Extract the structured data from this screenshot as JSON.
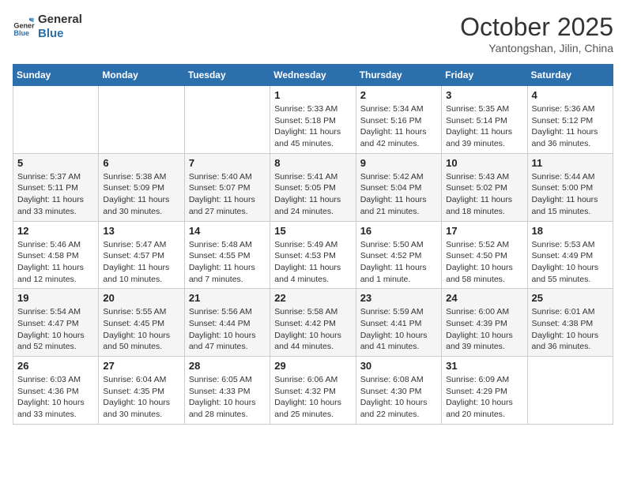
{
  "header": {
    "logo_line1": "General",
    "logo_line2": "Blue",
    "month": "October 2025",
    "location": "Yantongshan, Jilin, China"
  },
  "weekdays": [
    "Sunday",
    "Monday",
    "Tuesday",
    "Wednesday",
    "Thursday",
    "Friday",
    "Saturday"
  ],
  "weeks": [
    [
      {
        "day": "",
        "info": ""
      },
      {
        "day": "",
        "info": ""
      },
      {
        "day": "",
        "info": ""
      },
      {
        "day": "1",
        "info": "Sunrise: 5:33 AM\nSunset: 5:18 PM\nDaylight: 11 hours\nand 45 minutes."
      },
      {
        "day": "2",
        "info": "Sunrise: 5:34 AM\nSunset: 5:16 PM\nDaylight: 11 hours\nand 42 minutes."
      },
      {
        "day": "3",
        "info": "Sunrise: 5:35 AM\nSunset: 5:14 PM\nDaylight: 11 hours\nand 39 minutes."
      },
      {
        "day": "4",
        "info": "Sunrise: 5:36 AM\nSunset: 5:12 PM\nDaylight: 11 hours\nand 36 minutes."
      }
    ],
    [
      {
        "day": "5",
        "info": "Sunrise: 5:37 AM\nSunset: 5:11 PM\nDaylight: 11 hours\nand 33 minutes."
      },
      {
        "day": "6",
        "info": "Sunrise: 5:38 AM\nSunset: 5:09 PM\nDaylight: 11 hours\nand 30 minutes."
      },
      {
        "day": "7",
        "info": "Sunrise: 5:40 AM\nSunset: 5:07 PM\nDaylight: 11 hours\nand 27 minutes."
      },
      {
        "day": "8",
        "info": "Sunrise: 5:41 AM\nSunset: 5:05 PM\nDaylight: 11 hours\nand 24 minutes."
      },
      {
        "day": "9",
        "info": "Sunrise: 5:42 AM\nSunset: 5:04 PM\nDaylight: 11 hours\nand 21 minutes."
      },
      {
        "day": "10",
        "info": "Sunrise: 5:43 AM\nSunset: 5:02 PM\nDaylight: 11 hours\nand 18 minutes."
      },
      {
        "day": "11",
        "info": "Sunrise: 5:44 AM\nSunset: 5:00 PM\nDaylight: 11 hours\nand 15 minutes."
      }
    ],
    [
      {
        "day": "12",
        "info": "Sunrise: 5:46 AM\nSunset: 4:58 PM\nDaylight: 11 hours\nand 12 minutes."
      },
      {
        "day": "13",
        "info": "Sunrise: 5:47 AM\nSunset: 4:57 PM\nDaylight: 11 hours\nand 10 minutes."
      },
      {
        "day": "14",
        "info": "Sunrise: 5:48 AM\nSunset: 4:55 PM\nDaylight: 11 hours\nand 7 minutes."
      },
      {
        "day": "15",
        "info": "Sunrise: 5:49 AM\nSunset: 4:53 PM\nDaylight: 11 hours\nand 4 minutes."
      },
      {
        "day": "16",
        "info": "Sunrise: 5:50 AM\nSunset: 4:52 PM\nDaylight: 11 hours\nand 1 minute."
      },
      {
        "day": "17",
        "info": "Sunrise: 5:52 AM\nSunset: 4:50 PM\nDaylight: 10 hours\nand 58 minutes."
      },
      {
        "day": "18",
        "info": "Sunrise: 5:53 AM\nSunset: 4:49 PM\nDaylight: 10 hours\nand 55 minutes."
      }
    ],
    [
      {
        "day": "19",
        "info": "Sunrise: 5:54 AM\nSunset: 4:47 PM\nDaylight: 10 hours\nand 52 minutes."
      },
      {
        "day": "20",
        "info": "Sunrise: 5:55 AM\nSunset: 4:45 PM\nDaylight: 10 hours\nand 50 minutes."
      },
      {
        "day": "21",
        "info": "Sunrise: 5:56 AM\nSunset: 4:44 PM\nDaylight: 10 hours\nand 47 minutes."
      },
      {
        "day": "22",
        "info": "Sunrise: 5:58 AM\nSunset: 4:42 PM\nDaylight: 10 hours\nand 44 minutes."
      },
      {
        "day": "23",
        "info": "Sunrise: 5:59 AM\nSunset: 4:41 PM\nDaylight: 10 hours\nand 41 minutes."
      },
      {
        "day": "24",
        "info": "Sunrise: 6:00 AM\nSunset: 4:39 PM\nDaylight: 10 hours\nand 39 minutes."
      },
      {
        "day": "25",
        "info": "Sunrise: 6:01 AM\nSunset: 4:38 PM\nDaylight: 10 hours\nand 36 minutes."
      }
    ],
    [
      {
        "day": "26",
        "info": "Sunrise: 6:03 AM\nSunset: 4:36 PM\nDaylight: 10 hours\nand 33 minutes."
      },
      {
        "day": "27",
        "info": "Sunrise: 6:04 AM\nSunset: 4:35 PM\nDaylight: 10 hours\nand 30 minutes."
      },
      {
        "day": "28",
        "info": "Sunrise: 6:05 AM\nSunset: 4:33 PM\nDaylight: 10 hours\nand 28 minutes."
      },
      {
        "day": "29",
        "info": "Sunrise: 6:06 AM\nSunset: 4:32 PM\nDaylight: 10 hours\nand 25 minutes."
      },
      {
        "day": "30",
        "info": "Sunrise: 6:08 AM\nSunset: 4:30 PM\nDaylight: 10 hours\nand 22 minutes."
      },
      {
        "day": "31",
        "info": "Sunrise: 6:09 AM\nSunset: 4:29 PM\nDaylight: 10 hours\nand 20 minutes."
      },
      {
        "day": "",
        "info": ""
      }
    ]
  ]
}
